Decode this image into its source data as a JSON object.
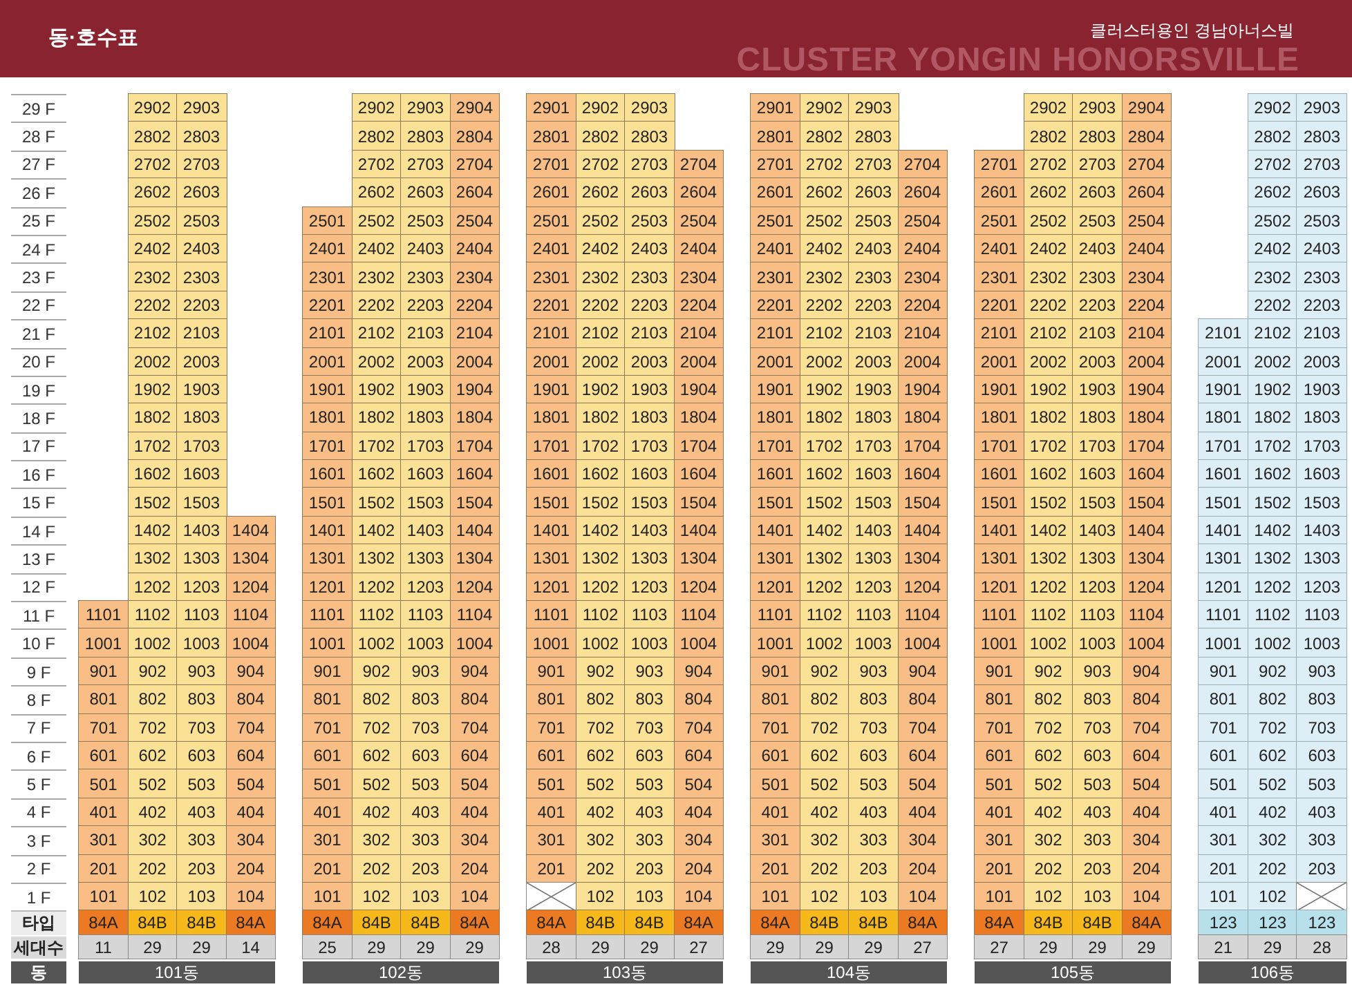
{
  "header": {
    "title": "동·호수표",
    "background_text": "CLUSTER YONGIN HONORSVILLE",
    "complex_name": "클러스터용인 경남아너스빌"
  },
  "floors": [
    "29 F",
    "28 F",
    "27 F",
    "26 F",
    "25 F",
    "24 F",
    "23 F",
    "22 F",
    "21 F",
    "20 F",
    "19 F",
    "18 F",
    "17 F",
    "16 F",
    "15 F",
    "14 F",
    "13 F",
    "12 F",
    "11 F",
    "10 F",
    "9 F",
    "8 F",
    "7 F",
    "6 F",
    "5 F",
    "4 F",
    "3 F",
    "2 F",
    "1 F"
  ],
  "row_labels": {
    "type": "타입",
    "households": "세대수",
    "building": "동"
  },
  "buildings": [
    {
      "name": "101동",
      "columns": [
        {
          "kind": "end",
          "type": "84A",
          "households": "11",
          "crossed_ground_floor": false,
          "units": [
            "1101",
            "1001",
            "901",
            "801",
            "701",
            "601",
            "501",
            "401",
            "301",
            "201",
            "101"
          ]
        },
        {
          "kind": "inner",
          "type": "84B",
          "households": "29",
          "crossed_ground_floor": false,
          "units": [
            "2902",
            "2802",
            "2702",
            "2602",
            "2502",
            "2402",
            "2302",
            "2202",
            "2102",
            "2002",
            "1902",
            "1802",
            "1702",
            "1602",
            "1502",
            "1402",
            "1302",
            "1202",
            "1102",
            "1002",
            "902",
            "802",
            "702",
            "602",
            "502",
            "402",
            "302",
            "202",
            "102"
          ]
        },
        {
          "kind": "inner",
          "type": "84B",
          "households": "29",
          "crossed_ground_floor": false,
          "units": [
            "2903",
            "2803",
            "2703",
            "2603",
            "2503",
            "2403",
            "2303",
            "2203",
            "2103",
            "2003",
            "1903",
            "1803",
            "1703",
            "1603",
            "1503",
            "1403",
            "1303",
            "1203",
            "1103",
            "1003",
            "903",
            "803",
            "703",
            "603",
            "503",
            "403",
            "303",
            "203",
            "103"
          ]
        },
        {
          "kind": "end",
          "type": "84A",
          "households": "14",
          "crossed_ground_floor": false,
          "units": [
            "1404",
            "1304",
            "1204",
            "1104",
            "1004",
            "904",
            "804",
            "704",
            "604",
            "504",
            "404",
            "304",
            "204",
            "104"
          ]
        }
      ]
    },
    {
      "name": "102동",
      "columns": [
        {
          "kind": "end",
          "type": "84A",
          "households": "25",
          "crossed_ground_floor": false,
          "units": [
            "2501",
            "2401",
            "2301",
            "2201",
            "2101",
            "2001",
            "1901",
            "1801",
            "1701",
            "1601",
            "1501",
            "1401",
            "1301",
            "1201",
            "1101",
            "1001",
            "901",
            "801",
            "701",
            "601",
            "501",
            "401",
            "301",
            "201",
            "101"
          ]
        },
        {
          "kind": "inner",
          "type": "84B",
          "households": "29",
          "crossed_ground_floor": false,
          "units": [
            "2902",
            "2802",
            "2702",
            "2602",
            "2502",
            "2402",
            "2302",
            "2202",
            "2102",
            "2002",
            "1902",
            "1802",
            "1702",
            "1602",
            "1502",
            "1402",
            "1302",
            "1202",
            "1102",
            "1002",
            "902",
            "802",
            "702",
            "602",
            "502",
            "402",
            "302",
            "202",
            "102"
          ]
        },
        {
          "kind": "inner",
          "type": "84B",
          "households": "29",
          "crossed_ground_floor": false,
          "units": [
            "2903",
            "2803",
            "2703",
            "2603",
            "2503",
            "2403",
            "2303",
            "2203",
            "2103",
            "2003",
            "1903",
            "1803",
            "1703",
            "1603",
            "1503",
            "1403",
            "1303",
            "1203",
            "1103",
            "1003",
            "903",
            "803",
            "703",
            "603",
            "503",
            "403",
            "303",
            "203",
            "103"
          ]
        },
        {
          "kind": "end",
          "type": "84A",
          "households": "29",
          "crossed_ground_floor": false,
          "units": [
            "2904",
            "2804",
            "2704",
            "2604",
            "2504",
            "2404",
            "2304",
            "2204",
            "2104",
            "2004",
            "1904",
            "1804",
            "1704",
            "1604",
            "1504",
            "1404",
            "1304",
            "1204",
            "1104",
            "1004",
            "904",
            "804",
            "704",
            "604",
            "504",
            "404",
            "304",
            "204",
            "104"
          ]
        }
      ]
    },
    {
      "name": "103동",
      "columns": [
        {
          "kind": "end",
          "type": "84A",
          "households": "28",
          "crossed_ground_floor": true,
          "units": [
            "2901",
            "2801",
            "2701",
            "2601",
            "2501",
            "2401",
            "2301",
            "2201",
            "2101",
            "2001",
            "1901",
            "1801",
            "1701",
            "1601",
            "1501",
            "1401",
            "1301",
            "1201",
            "1101",
            "1001",
            "901",
            "801",
            "701",
            "601",
            "501",
            "401",
            "301",
            "201"
          ]
        },
        {
          "kind": "inner",
          "type": "84B",
          "households": "29",
          "crossed_ground_floor": false,
          "units": [
            "2902",
            "2802",
            "2702",
            "2602",
            "2502",
            "2402",
            "2302",
            "2202",
            "2102",
            "2002",
            "1902",
            "1802",
            "1702",
            "1602",
            "1502",
            "1402",
            "1302",
            "1202",
            "1102",
            "1002",
            "902",
            "802",
            "702",
            "602",
            "502",
            "402",
            "302",
            "202",
            "102"
          ]
        },
        {
          "kind": "inner",
          "type": "84B",
          "households": "29",
          "crossed_ground_floor": false,
          "units": [
            "2903",
            "2803",
            "2703",
            "2603",
            "2503",
            "2403",
            "2303",
            "2203",
            "2103",
            "2003",
            "1903",
            "1803",
            "1703",
            "1603",
            "1503",
            "1403",
            "1303",
            "1203",
            "1103",
            "1003",
            "903",
            "803",
            "703",
            "603",
            "503",
            "403",
            "303",
            "203",
            "103"
          ]
        },
        {
          "kind": "end",
          "type": "84A",
          "households": "27",
          "crossed_ground_floor": false,
          "units": [
            "2704",
            "2604",
            "2504",
            "2404",
            "2304",
            "2204",
            "2104",
            "2004",
            "1904",
            "1804",
            "1704",
            "1604",
            "1504",
            "1404",
            "1304",
            "1204",
            "1104",
            "1004",
            "904",
            "804",
            "704",
            "604",
            "504",
            "404",
            "304",
            "204",
            "104"
          ]
        }
      ]
    },
    {
      "name": "104동",
      "columns": [
        {
          "kind": "end",
          "type": "84A",
          "households": "29",
          "crossed_ground_floor": false,
          "units": [
            "2901",
            "2801",
            "2701",
            "2601",
            "2501",
            "2401",
            "2301",
            "2201",
            "2101",
            "2001",
            "1901",
            "1801",
            "1701",
            "1601",
            "1501",
            "1401",
            "1301",
            "1201",
            "1101",
            "1001",
            "901",
            "801",
            "701",
            "601",
            "501",
            "401",
            "301",
            "201",
            "101"
          ]
        },
        {
          "kind": "inner",
          "type": "84B",
          "households": "29",
          "crossed_ground_floor": false,
          "units": [
            "2902",
            "2802",
            "2702",
            "2602",
            "2502",
            "2402",
            "2302",
            "2202",
            "2102",
            "2002",
            "1902",
            "1802",
            "1702",
            "1602",
            "1502",
            "1402",
            "1302",
            "1202",
            "1102",
            "1002",
            "902",
            "802",
            "702",
            "602",
            "502",
            "402",
            "302",
            "202",
            "102"
          ]
        },
        {
          "kind": "inner",
          "type": "84B",
          "households": "29",
          "crossed_ground_floor": false,
          "units": [
            "2903",
            "2803",
            "2703",
            "2603",
            "2503",
            "2403",
            "2303",
            "2203",
            "2103",
            "2003",
            "1903",
            "1803",
            "1703",
            "1603",
            "1503",
            "1403",
            "1303",
            "1203",
            "1103",
            "1003",
            "903",
            "803",
            "703",
            "603",
            "503",
            "403",
            "303",
            "203",
            "103"
          ]
        },
        {
          "kind": "end",
          "type": "84A",
          "households": "27",
          "crossed_ground_floor": false,
          "units": [
            "2704",
            "2604",
            "2504",
            "2404",
            "2304",
            "2204",
            "2104",
            "2004",
            "1904",
            "1804",
            "1704",
            "1604",
            "1504",
            "1404",
            "1304",
            "1204",
            "1104",
            "1004",
            "904",
            "804",
            "704",
            "604",
            "504",
            "404",
            "304",
            "204",
            "104"
          ]
        }
      ]
    },
    {
      "name": "105동",
      "columns": [
        {
          "kind": "end",
          "type": "84A",
          "households": "27",
          "crossed_ground_floor": false,
          "units": [
            "2701",
            "2601",
            "2501",
            "2401",
            "2301",
            "2201",
            "2101",
            "2001",
            "1901",
            "1801",
            "1701",
            "1601",
            "1501",
            "1401",
            "1301",
            "1201",
            "1101",
            "1001",
            "901",
            "801",
            "701",
            "601",
            "501",
            "401",
            "301",
            "201",
            "101"
          ]
        },
        {
          "kind": "inner",
          "type": "84B",
          "households": "29",
          "crossed_ground_floor": false,
          "units": [
            "2902",
            "2802",
            "2702",
            "2602",
            "2502",
            "2402",
            "2302",
            "2202",
            "2102",
            "2002",
            "1902",
            "1802",
            "1702",
            "1602",
            "1502",
            "1402",
            "1302",
            "1202",
            "1102",
            "1002",
            "902",
            "802",
            "702",
            "602",
            "502",
            "402",
            "302",
            "202",
            "102"
          ]
        },
        {
          "kind": "inner",
          "type": "84B",
          "households": "29",
          "crossed_ground_floor": false,
          "units": [
            "2903",
            "2803",
            "2703",
            "2603",
            "2503",
            "2403",
            "2303",
            "2203",
            "2103",
            "2003",
            "1903",
            "1803",
            "1703",
            "1603",
            "1503",
            "1403",
            "1303",
            "1203",
            "1103",
            "1003",
            "903",
            "803",
            "703",
            "603",
            "503",
            "403",
            "303",
            "203",
            "103"
          ]
        },
        {
          "kind": "end",
          "type": "84A",
          "households": "29",
          "crossed_ground_floor": false,
          "units": [
            "2904",
            "2804",
            "2704",
            "2604",
            "2504",
            "2404",
            "2304",
            "2204",
            "2104",
            "2004",
            "1904",
            "1804",
            "1704",
            "1604",
            "1504",
            "1404",
            "1304",
            "1204",
            "1104",
            "1004",
            "904",
            "804",
            "704",
            "604",
            "504",
            "404",
            "304",
            "204",
            "104"
          ]
        }
      ]
    },
    {
      "name": "106동",
      "columns": [
        {
          "kind": "alt",
          "type": "123",
          "households": "21",
          "crossed_ground_floor": false,
          "units": [
            "2101",
            "2001",
            "1901",
            "1801",
            "1701",
            "1601",
            "1501",
            "1401",
            "1301",
            "1201",
            "1101",
            "1001",
            "901",
            "801",
            "701",
            "601",
            "501",
            "401",
            "301",
            "201",
            "101"
          ]
        },
        {
          "kind": "alt",
          "type": "123",
          "households": "29",
          "crossed_ground_floor": false,
          "units": [
            "2902",
            "2802",
            "2702",
            "2602",
            "2502",
            "2402",
            "2302",
            "2202",
            "2102",
            "2002",
            "1902",
            "1802",
            "1702",
            "1602",
            "1502",
            "1402",
            "1302",
            "1202",
            "1102",
            "1002",
            "902",
            "802",
            "702",
            "602",
            "502",
            "402",
            "302",
            "202",
            "102"
          ]
        },
        {
          "kind": "alt",
          "type": "123",
          "households": "28",
          "crossed_ground_floor": true,
          "units": [
            "2903",
            "2803",
            "2703",
            "2603",
            "2503",
            "2403",
            "2303",
            "2203",
            "2103",
            "2003",
            "1903",
            "1803",
            "1703",
            "1603",
            "1503",
            "1403",
            "1303",
            "1203",
            "1103",
            "1003",
            "903",
            "803",
            "703",
            "603",
            "503",
            "403",
            "303",
            "203"
          ]
        }
      ]
    }
  ]
}
